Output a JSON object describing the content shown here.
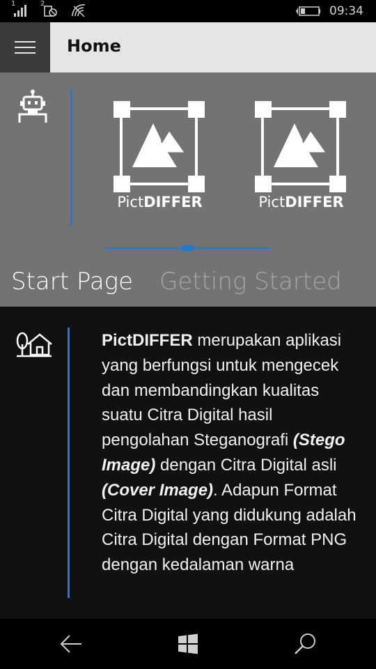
{
  "status_bar": {
    "time": "09:34",
    "signal1_sim": "1",
    "signal2_sim": "2"
  },
  "header": {
    "title": "Home"
  },
  "hero": {
    "logos": [
      {
        "light": "Pict",
        "bold": "DIFFER"
      },
      {
        "light": "Pict",
        "bold": "DIFFER"
      }
    ]
  },
  "pivot": {
    "tabs": [
      {
        "label": "Start Page",
        "active": true
      },
      {
        "label": "Getting Started",
        "active": false
      }
    ]
  },
  "content": {
    "app_name": "PictDIFFER",
    "text_1": " merupakan aplikasi yang berfungsi untuk mengecek dan membandingkan kualitas suatu Citra Digital hasil pengolahan Steganografi ",
    "emph_1": "(Stego Image)",
    "text_2": " dengan Citra Digital asli ",
    "emph_2": "(Cover Image)",
    "text_3": ". Adapun Format Citra Digital yang didukung adalah Citra Digital dengan Format PNG dengan kedalaman warna"
  },
  "colors": {
    "accent": "#1e7ad6",
    "hero_bg": "#737373",
    "header_bg": "#e5e5e5",
    "content_bg": "#111111"
  },
  "icons": {
    "menu": "hamburger-icon",
    "robot": "robot-icon",
    "home": "tree-house-icon",
    "back": "back-arrow-icon",
    "start": "windows-logo-icon",
    "search": "search-icon"
  }
}
